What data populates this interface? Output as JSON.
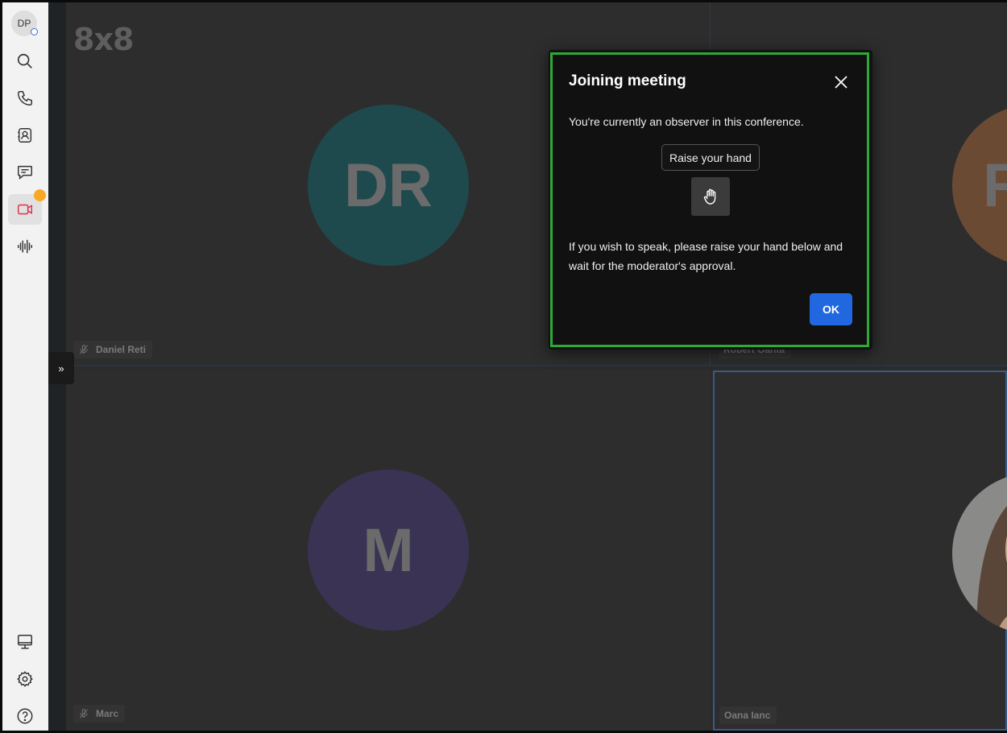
{
  "app": {
    "logo": "8x8"
  },
  "sidebar": {
    "avatar_initials": "DP",
    "items": [
      {
        "icon": "search-icon"
      },
      {
        "icon": "phone-icon"
      },
      {
        "icon": "contacts-icon"
      },
      {
        "icon": "chat-icon"
      },
      {
        "icon": "video-icon",
        "active": true,
        "notification": true
      },
      {
        "icon": "voice-waveform-icon"
      }
    ],
    "bottom_items": [
      {
        "icon": "monitor-icon"
      },
      {
        "icon": "gear-icon"
      },
      {
        "icon": "help-icon"
      }
    ]
  },
  "expand_button": {
    "glyph": "»"
  },
  "participants": [
    {
      "initials": "DR",
      "name": "Daniel Reti",
      "color": "#1f4a4d",
      "muted": true
    },
    {
      "initials": "R",
      "name": "Robert Oanta",
      "color": "#6b4a34",
      "muted": false
    },
    {
      "initials": "M",
      "name": "Marc",
      "color": "#3a3354",
      "muted": true
    },
    {
      "name": "Oana Ianc",
      "has_photo": true,
      "muted": false
    }
  ],
  "dialog": {
    "title": "Joining meeting",
    "observer_text": "You're currently an observer in this conference.",
    "raise_hand_label": "Raise your hand",
    "raise_hand_icon": "hand-icon",
    "info_text": "If you wish to speak, please raise your hand below and wait for the moderator's approval.",
    "ok_label": "OK"
  },
  "colors": {
    "accent": "#2168e0",
    "dialog_border": "#2ea836",
    "notification": "#f9a825",
    "active_video": "#e0314b"
  }
}
